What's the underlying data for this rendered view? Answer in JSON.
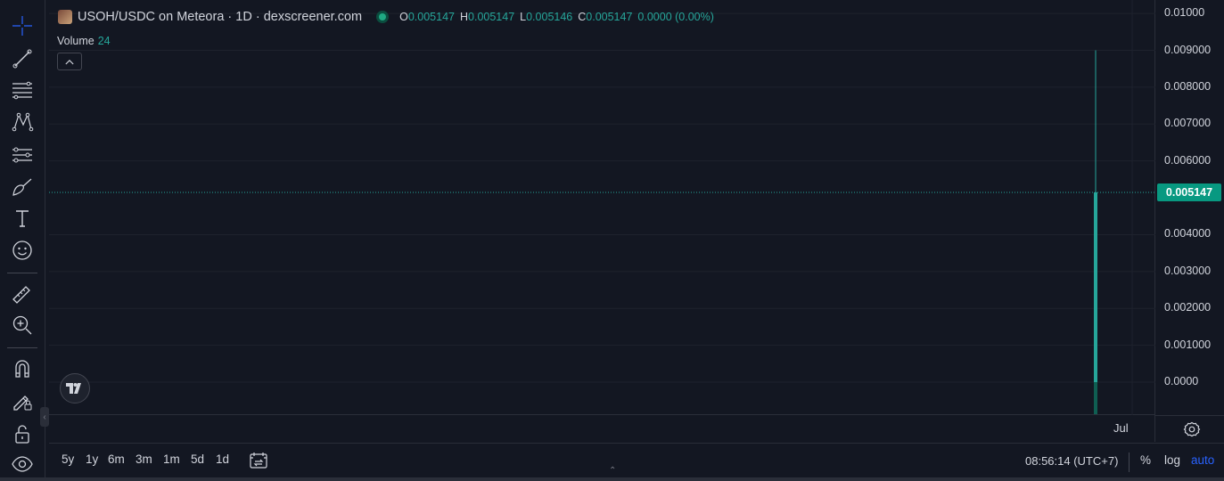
{
  "legend": {
    "symbol": "USOH/USDC on Meteora · 1D · dexscreener.com",
    "ohlc": [
      {
        "key": "O",
        "value": "0.005147"
      },
      {
        "key": "H",
        "value": "0.005147"
      },
      {
        "key": "L",
        "value": "0.005146"
      },
      {
        "key": "C",
        "value": "0.005147"
      }
    ],
    "change": "0.0000 (0.00%)",
    "volume_label": "Volume",
    "volume_value": "24"
  },
  "price_scale": {
    "ticks": [
      "0.01000",
      "0.009000",
      "0.008000",
      "0.007000",
      "0.006000",
      "0.004000",
      "0.003000",
      "0.002000",
      "0.001000",
      "0.0000"
    ],
    "current_price": "0.005147"
  },
  "time_scale": {
    "label": "Jul"
  },
  "bottom_bar": {
    "ranges": [
      "5y",
      "1y",
      "6m",
      "3m",
      "1m",
      "5d",
      "1d"
    ],
    "clock": "08:56:14 (UTC+7)",
    "percent_label": "%",
    "log_label": "log",
    "auto_label": "auto"
  },
  "colors": {
    "background": "#131722",
    "up": "#26a69a",
    "badge": "#089981",
    "accent": "#2962ff",
    "grid": "#1e222d"
  },
  "toolbar_icons": [
    "crosshair-icon",
    "trend-line-icon",
    "fib-retracement-icon",
    "pattern-icon",
    "prediction-icon",
    "brush-icon",
    "text-icon",
    "emoji-icon",
    "ruler-icon",
    "zoom-in-icon",
    "magnet-icon",
    "lock-drawings-icon",
    "unlock-icon",
    "eye-icon"
  ],
  "chart_data": {
    "type": "bar",
    "ylim": [
      -0.0008,
      0.0101
    ],
    "candles": [
      {
        "open": 0.0,
        "high": 0.009,
        "low": 0.0,
        "close": 0.005147
      }
    ],
    "last_price": 0.005147
  }
}
